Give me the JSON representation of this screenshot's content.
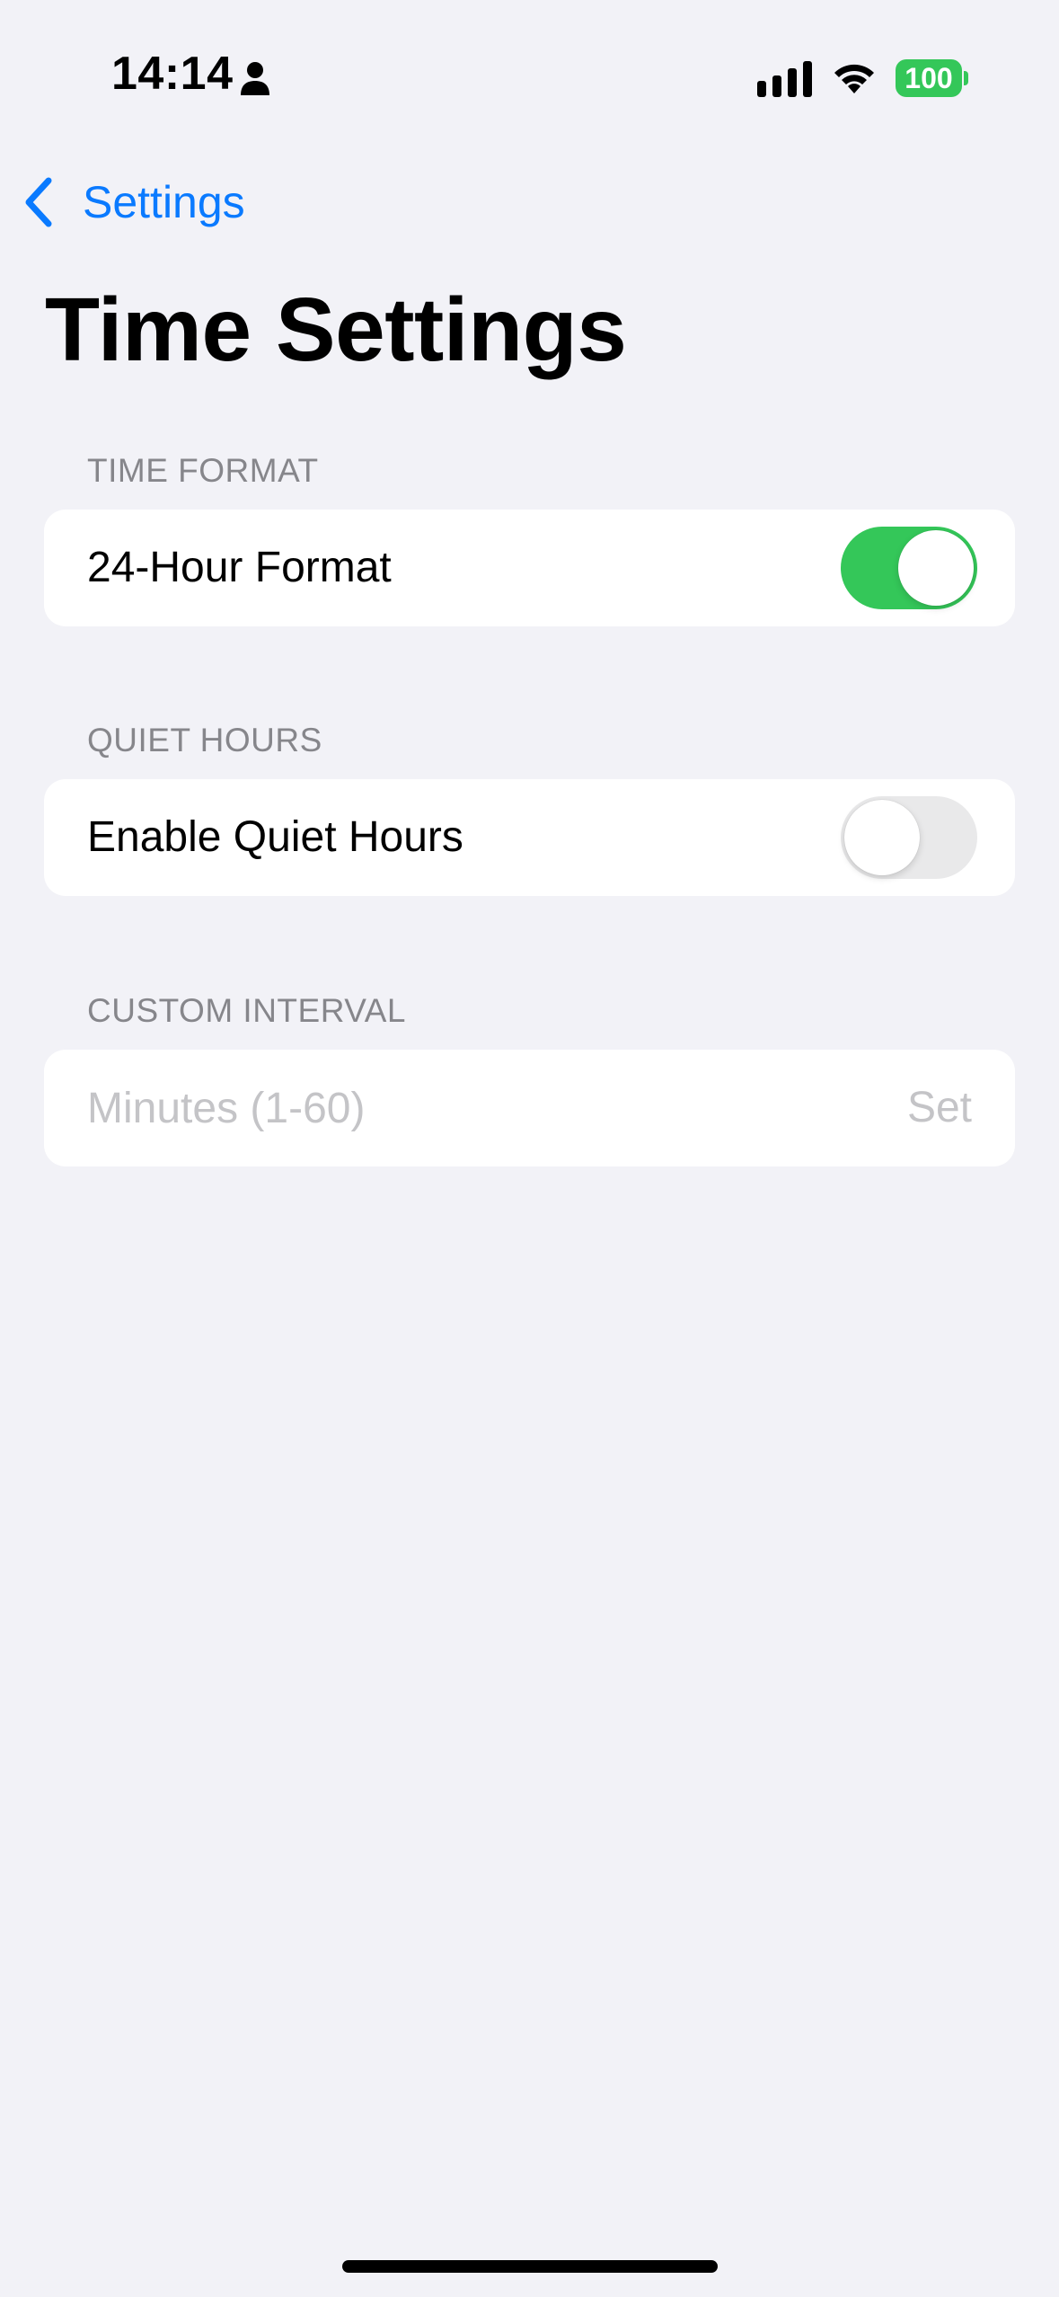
{
  "status_bar": {
    "time": "14:14",
    "battery": "100",
    "icons": [
      "person-icon",
      "cellular-signal-icon",
      "wifi-icon",
      "battery-icon"
    ]
  },
  "nav": {
    "back_label": "Settings",
    "back_icon": "chevron-left-icon"
  },
  "page": {
    "title": "Time Settings"
  },
  "sections": {
    "time_format": {
      "header": "TIME FORMAT",
      "row_label": "24-Hour Format",
      "toggle_on": true
    },
    "quiet_hours": {
      "header": "QUIET HOURS",
      "row_label": "Enable Quiet Hours",
      "toggle_on": false
    },
    "custom_interval": {
      "header": "CUSTOM INTERVAL",
      "input_value": "",
      "input_placeholder": "Minutes (1-60)",
      "set_label": "Set"
    }
  },
  "colors": {
    "accent": "#0a7aff",
    "toggle_on": "#34c759",
    "toggle_off": "#e9e9ea",
    "background": "#f2f2f7",
    "section_header": "#86868b",
    "placeholder": "#c4c4c7"
  }
}
